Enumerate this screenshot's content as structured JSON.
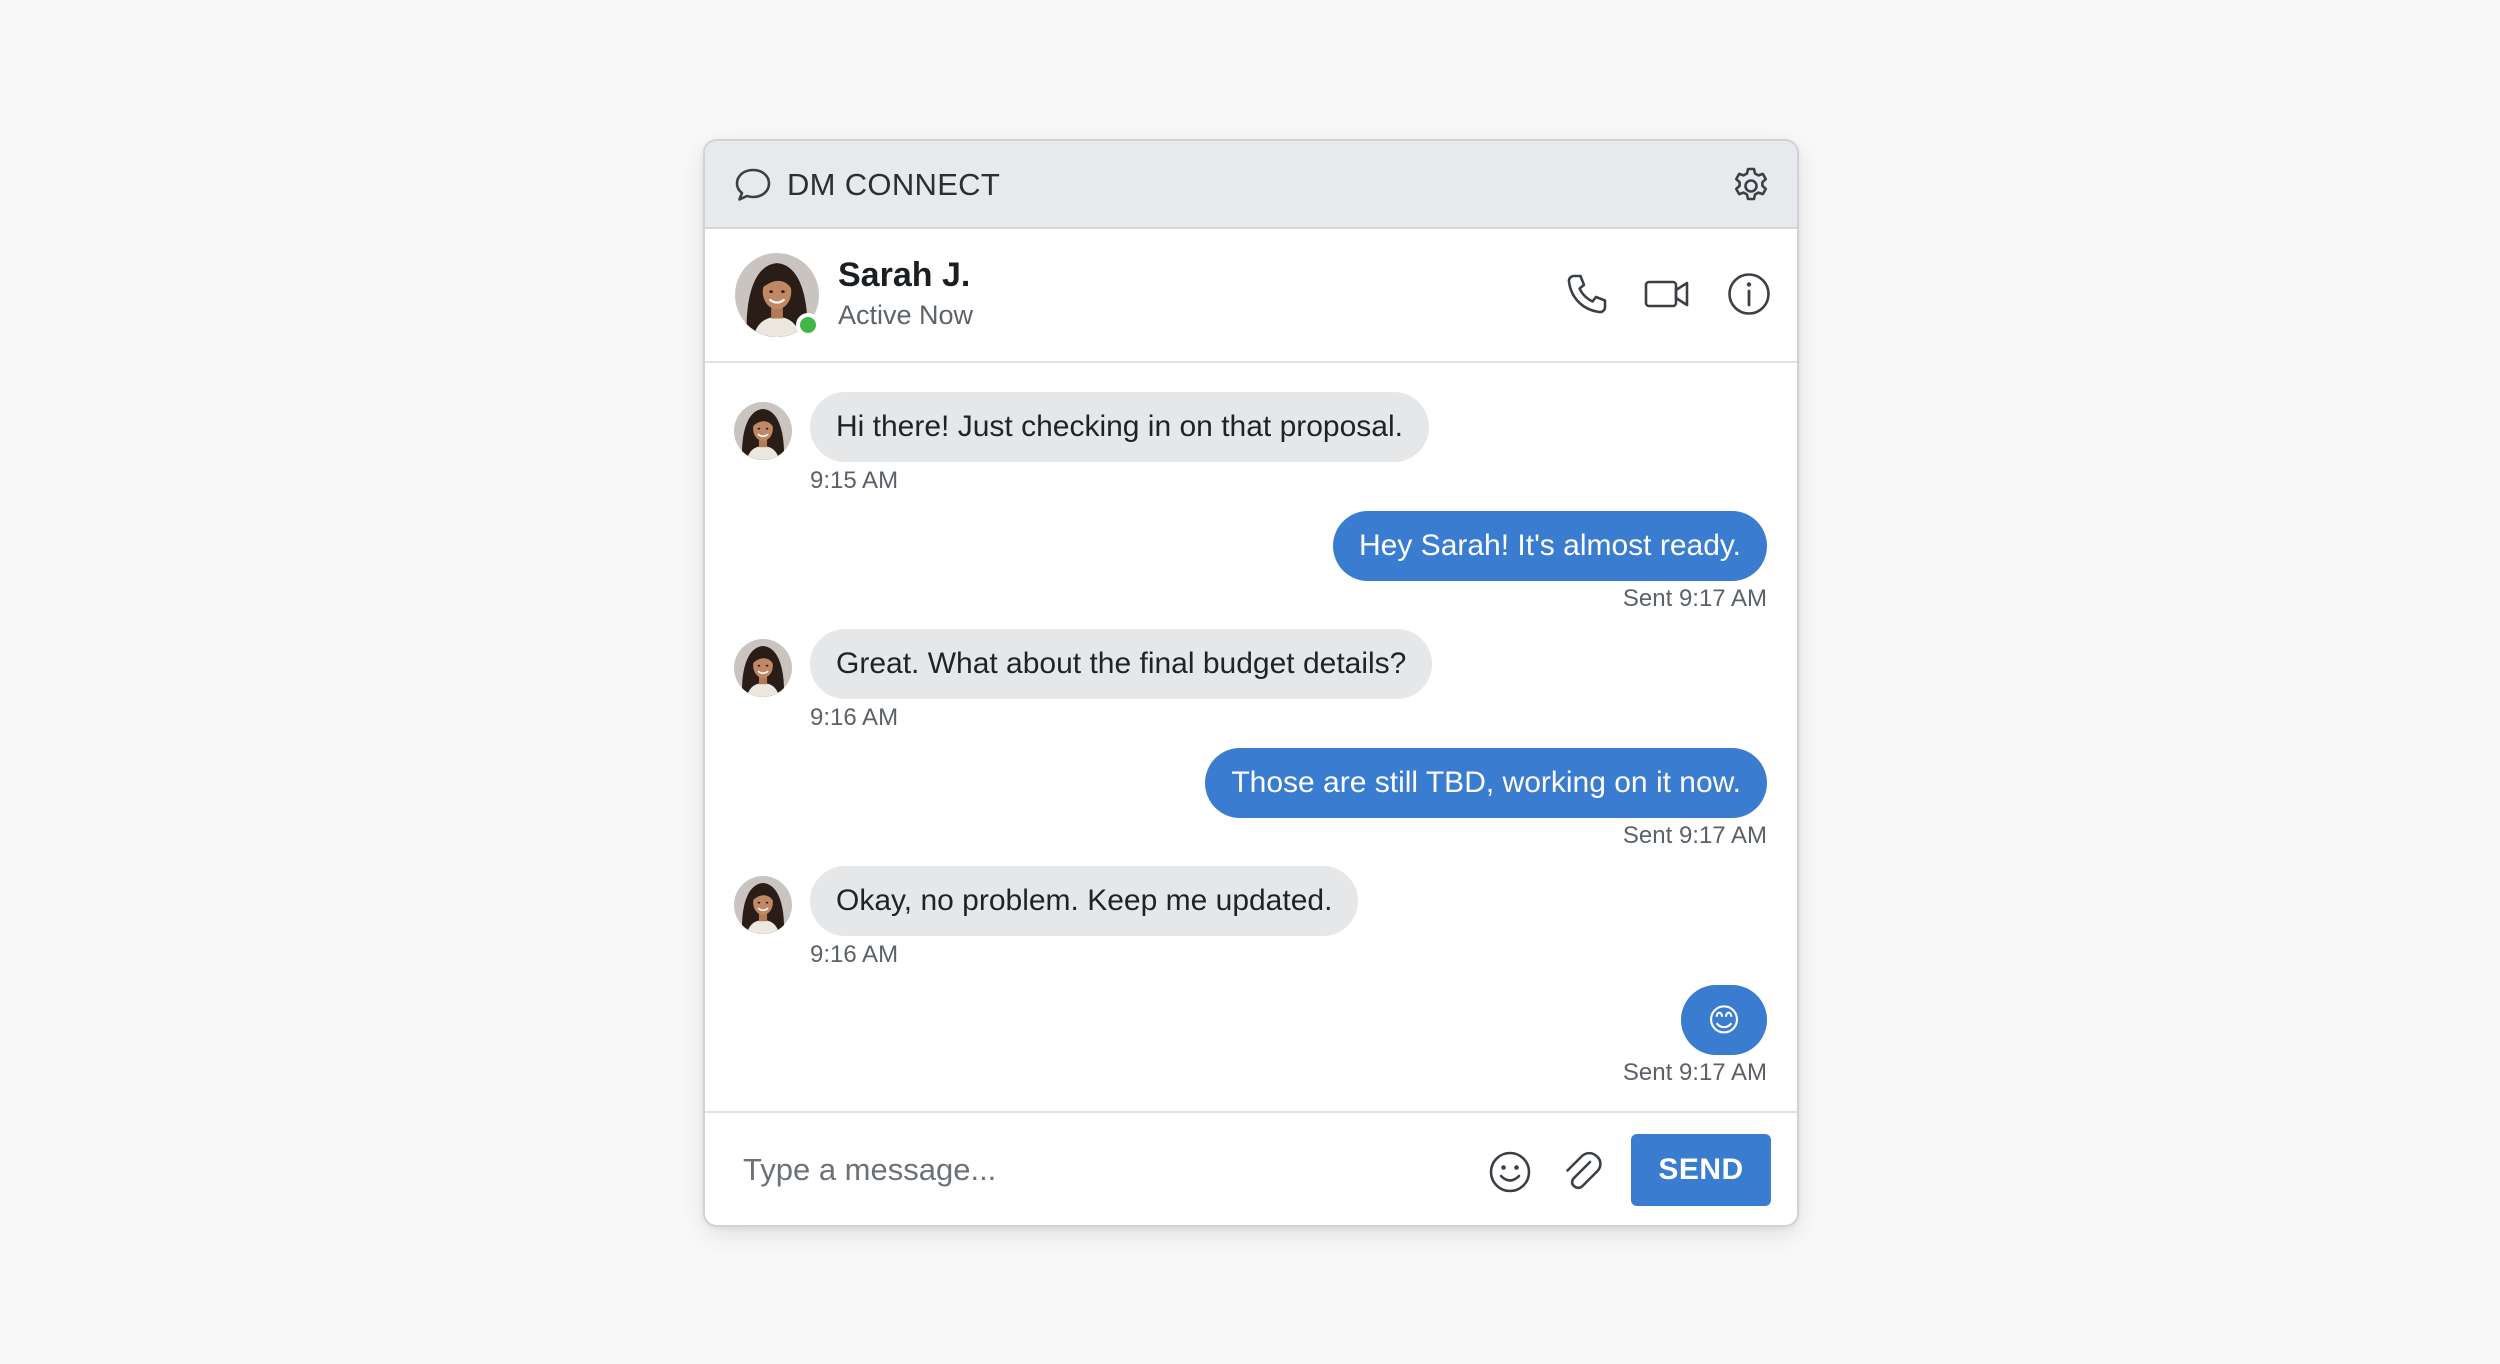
{
  "app": {
    "title": "DM CONNECT",
    "icons": {
      "app": "chat-bubble-icon",
      "settings": "gear-icon"
    }
  },
  "contact": {
    "name": "Sarah J.",
    "status": "Active Now",
    "presence_color": "#43b649",
    "actions": [
      "phone-icon",
      "video-camera-icon",
      "info-icon"
    ]
  },
  "messages": [
    {
      "direction": "incoming",
      "text": "Hi there! Just checking in on that proposal.",
      "time": "9:15 AM"
    },
    {
      "direction": "outgoing",
      "text": "Hey Sarah! It's almost ready.",
      "time": "Sent 9:17 AM"
    },
    {
      "direction": "incoming",
      "text": "Great. What about the final budget details?",
      "time": "9:16 AM"
    },
    {
      "direction": "outgoing",
      "text": "Those are still TBD, working on it now.",
      "time": "Sent 9:17 AM"
    },
    {
      "direction": "incoming",
      "text": "Okay, no problem. Keep me updated.",
      "time": "9:16 AM"
    },
    {
      "direction": "outgoing",
      "text": "😊",
      "time": "Sent 9:17 AM"
    }
  ],
  "composer": {
    "placeholder": "Type a message...",
    "value": "",
    "send_label": "SEND",
    "icons": [
      "smiley-icon",
      "paperclip-icon"
    ]
  },
  "colors": {
    "accent": "#3a7cd0",
    "incoming_bubble": "#e6e7e9",
    "titlebar": "#e8e9ec"
  }
}
